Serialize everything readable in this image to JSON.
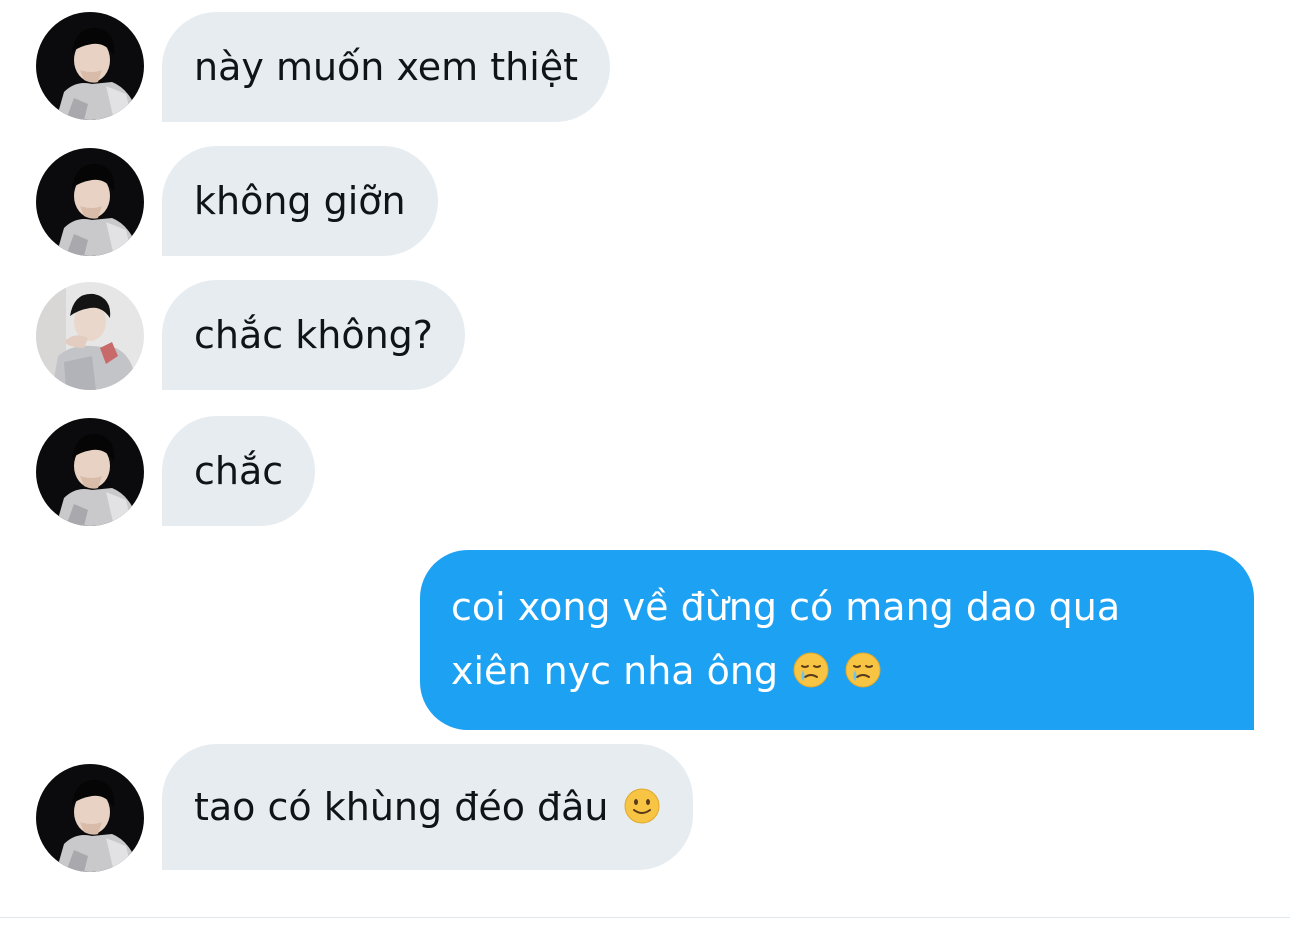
{
  "colors": {
    "incoming_bubble": "#e6ecf0",
    "outgoing_bubble": "#1da1f2",
    "incoming_text": "#0f1419",
    "outgoing_text": "#ffffff"
  },
  "messages": [
    {
      "direction": "received",
      "avatar": "avatar-dark-profile",
      "text": "này muốn xem thiệt"
    },
    {
      "direction": "received",
      "avatar": "avatar-dark-profile",
      "text": "không giỡn"
    },
    {
      "direction": "received",
      "avatar": "avatar-light-profile",
      "text": "chắc không?"
    },
    {
      "direction": "received",
      "avatar": "avatar-dark-profile",
      "text": "chắc"
    },
    {
      "direction": "sent",
      "lines": [
        "coi xong về đừng có mang dao qua",
        "xiên nyc nha ông"
      ],
      "emojis": [
        "crying-face-icon",
        "crying-face-icon"
      ]
    },
    {
      "direction": "received",
      "avatar": "avatar-dark-profile",
      "text": "tao có khùng đéo đâu",
      "emojis": [
        "slightly-smiling-face-icon"
      ]
    }
  ]
}
